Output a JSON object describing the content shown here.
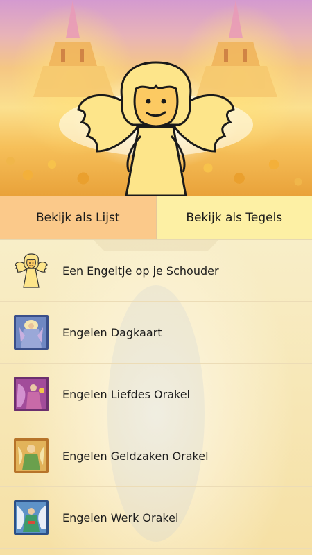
{
  "toggle": {
    "list_label": "Bekijk als Lijst",
    "tiles_label": "Bekijk als Tegels"
  },
  "items": [
    {
      "label": "Een Engeltje op je Schouder",
      "icon": "cartoon-angel-icon"
    },
    {
      "label": "Engelen Dagkaart",
      "icon": "angel-card-thumbnail"
    },
    {
      "label": "Engelen Liefdes Orakel",
      "icon": "angel-card-thumbnail"
    },
    {
      "label": "Engelen Geldzaken Orakel",
      "icon": "angel-card-thumbnail"
    },
    {
      "label": "Engelen Werk Orakel",
      "icon": "angel-card-thumbnail"
    }
  ],
  "colors": {
    "list_button_bg": "#fbc98a",
    "tiles_button_bg": "#fdf0a4",
    "angel_fill": "#fde58a"
  }
}
